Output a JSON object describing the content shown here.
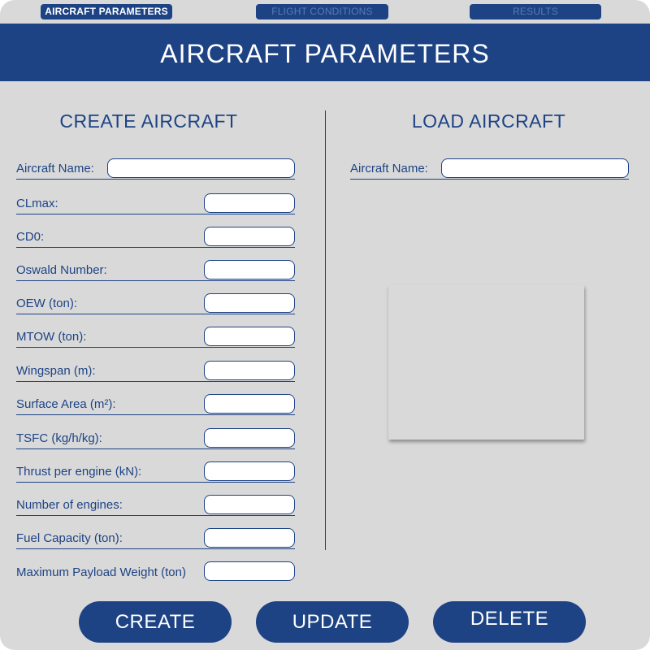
{
  "nav": {
    "tabs": [
      {
        "label": "AIRCRAFT PARAMETERS",
        "active": true
      },
      {
        "label": "FLIGHT CONDITIONS",
        "active": false
      },
      {
        "label": "RESULTS",
        "active": false
      }
    ]
  },
  "header": {
    "title": "AIRCRAFT PARAMETERS"
  },
  "create": {
    "title": "CREATE AIRCRAFT",
    "fields": [
      {
        "label": "Aircraft Name:",
        "value": ""
      },
      {
        "label": "CLmax:",
        "value": ""
      },
      {
        "label": "CD0:",
        "value": ""
      },
      {
        "label": "Oswald Number:",
        "value": ""
      },
      {
        "label": "OEW (ton):",
        "value": ""
      },
      {
        "label": "MTOW (ton):",
        "value": ""
      },
      {
        "label": "Wingspan (m):",
        "value": ""
      },
      {
        "label": "Surface Area (m²):",
        "value": ""
      },
      {
        "label": "TSFC (kg/h/kg):",
        "value": ""
      },
      {
        "label": "Thrust per engine (kN):",
        "value": ""
      },
      {
        "label": "Number of engines:",
        "value": ""
      },
      {
        "label": "Fuel Capacity (ton):",
        "value": ""
      },
      {
        "label": "Maximum Payload Weight (ton)",
        "value": ""
      }
    ]
  },
  "load": {
    "title": "LOAD AIRCRAFT",
    "name_label": "Aircraft Name:",
    "name_value": ""
  },
  "buttons": {
    "create": "CREATE",
    "update": "UPDATE",
    "delete": "DELETE"
  },
  "colors": {
    "primary": "#1d4385",
    "background": "#d9d9d9",
    "inactive_tab_text": "#5a7ab3"
  }
}
